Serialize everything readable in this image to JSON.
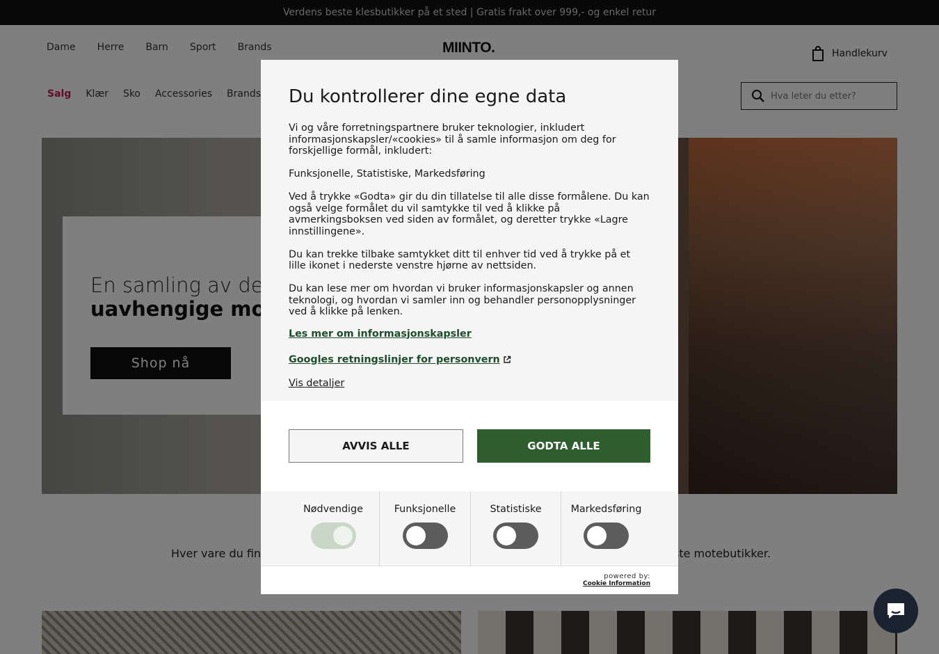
{
  "topbar": {
    "text": "Verdens beste klesbutikker på et sted | Gratis frakt over 999,- og enkel retur"
  },
  "header": {
    "logo": "MIINTO.",
    "nav": [
      "Dame",
      "Herre",
      "Barn",
      "Sport",
      "Brands"
    ],
    "cart_label": "Handlekurv",
    "subnav": [
      "Salg",
      "Klær",
      "Sko",
      "Accessories",
      "Brands"
    ],
    "search_placeholder": "Hva leter du etter?"
  },
  "hero": {
    "line1": "En samling av de",
    "line2": "uavhengige mote",
    "button": "Shop nå"
  },
  "tagline": {
    "left": "Hver vare du finn",
    "right": "ste motebutikker."
  },
  "consent": {
    "title": "Du kontrollerer dine egne data",
    "paragraphs": [
      "Vi og våre forretningspartnere bruker teknologier, inkludert informasjonskapsler/«cookies» til å samle informasjon om deg for forskjellige formål, inkludert:",
      "Funksjonelle, Statistiske, Markedsføring",
      "Ved å trykke «Godta» gir du din tillatelse til alle disse formålene. Du kan også velge formålet du vil samtykke til ved å klikke på avmerkingsboksen ved siden av formålet, og deretter trykke «Lagre innstillingene».",
      "Du kan trekke tilbake samtykket ditt til enhver tid ved å trykke på et lille ikonet i nederste venstre hjørne av nettsiden.",
      "Du kan lese mer om hvordan vi bruker informasjonskapsler og annen teknologi, og hvordan vi samler inn og behandler personopplysninger ved å klikke på lenken."
    ],
    "link_cookies": "Les mer om informasjonskapsler",
    "link_google": "Googles retningslinjer for personvern",
    "link_details": "Vis detaljer",
    "reject_label": "AVVIS ALLE",
    "accept_label": "GODTA ALLE",
    "toggles": [
      {
        "label": "Nødvendige",
        "state": "on"
      },
      {
        "label": "Funksjonelle",
        "state": "off"
      },
      {
        "label": "Statistiske",
        "state": "off"
      },
      {
        "label": "Markedsføring",
        "state": "off"
      }
    ],
    "powered_by": "powered by:",
    "powered_brand": "Cookie Information"
  },
  "colors": {
    "accent_green": "#2e5e2d",
    "sale_pink": "#c2185b",
    "chat_bg": "#1a2230"
  }
}
